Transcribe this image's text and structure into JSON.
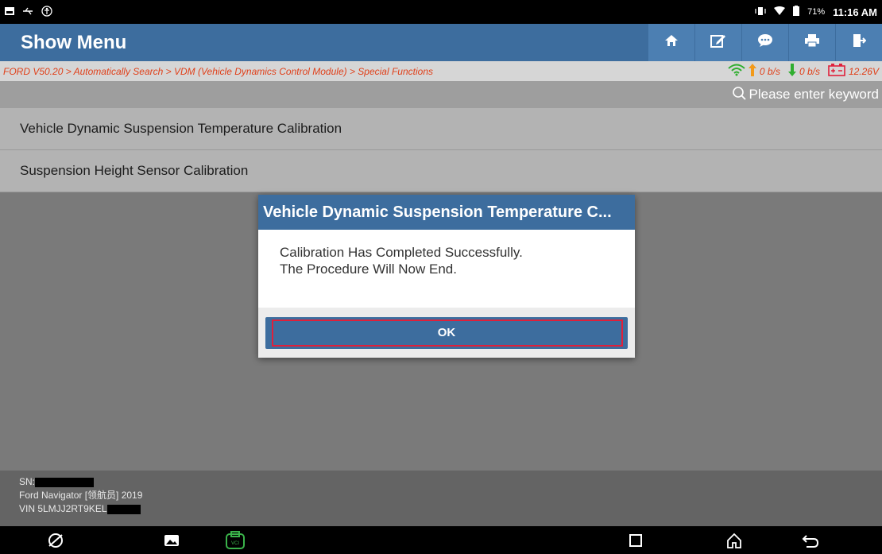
{
  "status_bar": {
    "time": "11:16 AM",
    "battery_percent": "71%",
    "left_icons": [
      "notification-icon",
      "usb-icon",
      "accessibility-icon"
    ],
    "right_icons": [
      "vibrate-icon",
      "wifi-icon",
      "battery-icon"
    ]
  },
  "header": {
    "title": "Show Menu",
    "toolbar": [
      "home-icon",
      "edit-icon",
      "message-icon",
      "print-icon",
      "exit-icon"
    ]
  },
  "breadcrumb": {
    "path": "FORD V50.20 > Automatically Search > VDM (Vehicle Dynamics Control Module) > Special Functions",
    "upload_speed": "0 b/s",
    "download_speed": "0 b/s",
    "voltage": "12.26V"
  },
  "search": {
    "placeholder": "Please enter keyword"
  },
  "menu": {
    "items": [
      {
        "label": "Vehicle Dynamic Suspension Temperature Calibration"
      },
      {
        "label": "Suspension Height Sensor Calibration"
      }
    ]
  },
  "dialog": {
    "title": "Vehicle Dynamic Suspension Temperature C...",
    "message_line1": "Calibration Has Completed Successfully.",
    "message_line2": "The Procedure Will Now End.",
    "ok_label": "OK"
  },
  "footer": {
    "sn_label": "SN:",
    "vehicle": "Ford Navigator [领航员] 2019",
    "vin_label": "VIN 5LMJJ2RT9KEL"
  },
  "nav_bar": {
    "icons": [
      "browser-icon",
      "gallery-icon",
      "vci-icon",
      "recent-apps-icon",
      "home-nav-icon",
      "back-icon"
    ]
  },
  "colors": {
    "header_blue": "#3d6d9e",
    "breadcrumb_text": "#e0401a",
    "highlight_red": "#e0203a"
  }
}
